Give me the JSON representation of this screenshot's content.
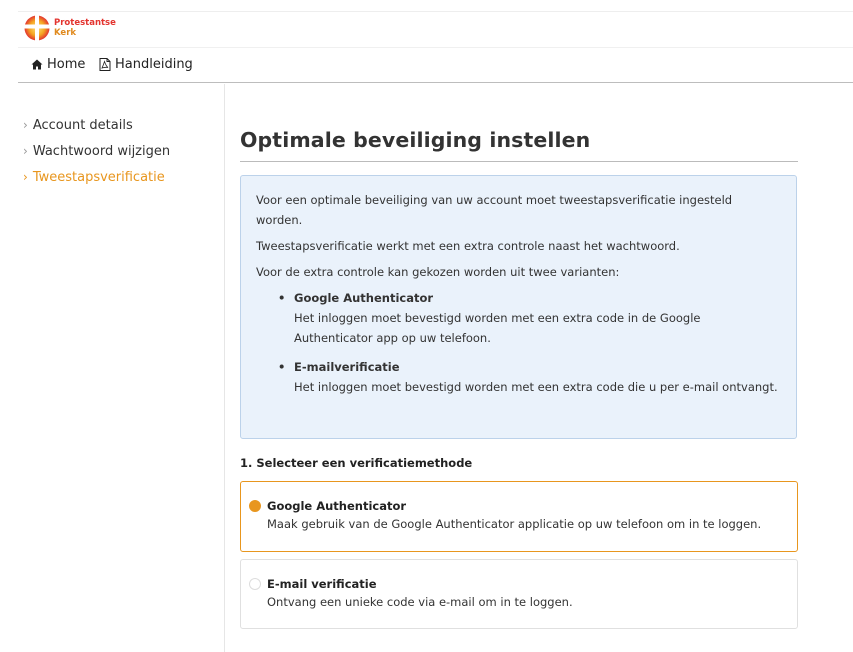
{
  "brand": {
    "line1": "Protestantse",
    "line2": "Kerk",
    "logo_icon": "cross-sun-logo",
    "colors": {
      "red": "#e3342f",
      "orange": "#e8961e"
    }
  },
  "nav": {
    "home_label": "Home",
    "home_icon": "home-icon",
    "manual_label": "Handleiding",
    "manual_icon": "pdf-file-icon"
  },
  "sidebar": {
    "items": [
      {
        "label": "Account details",
        "active": false
      },
      {
        "label": "Wachtwoord wijzigen",
        "active": false
      },
      {
        "label": "Tweestapsverificatie",
        "active": true
      }
    ]
  },
  "main": {
    "title": "Optimale beveiliging instellen",
    "info": {
      "p1": "Voor een optimale beveiliging van uw account moet tweestapsverificatie ingesteld worden.",
      "p2": "Tweestapsverificatie werkt met een extra controle naast het wachtwoord.",
      "p3": "Voor de extra controle kan gekozen worden uit twee varianten:",
      "items": [
        {
          "title": "Google Authenticator",
          "text": "Het inloggen moet bevestigd worden met een extra code in de Google Authenticator app op uw telefoon."
        },
        {
          "title": "E-mailverificatie",
          "text": "Het inloggen moet bevestigd worden met een extra code die u per e-mail ontvangt."
        }
      ]
    },
    "step_label": "1. Selecteer een verificatiemethode",
    "options": [
      {
        "title": "Google Authenticator",
        "desc": "Maak gebruik van de Google Authenticator applicatie op uw telefoon om in te loggen.",
        "selected": true
      },
      {
        "title": "E-mail verificatie",
        "desc": "Ontvang een unieke code via e-mail om in te loggen.",
        "selected": false
      }
    ]
  }
}
